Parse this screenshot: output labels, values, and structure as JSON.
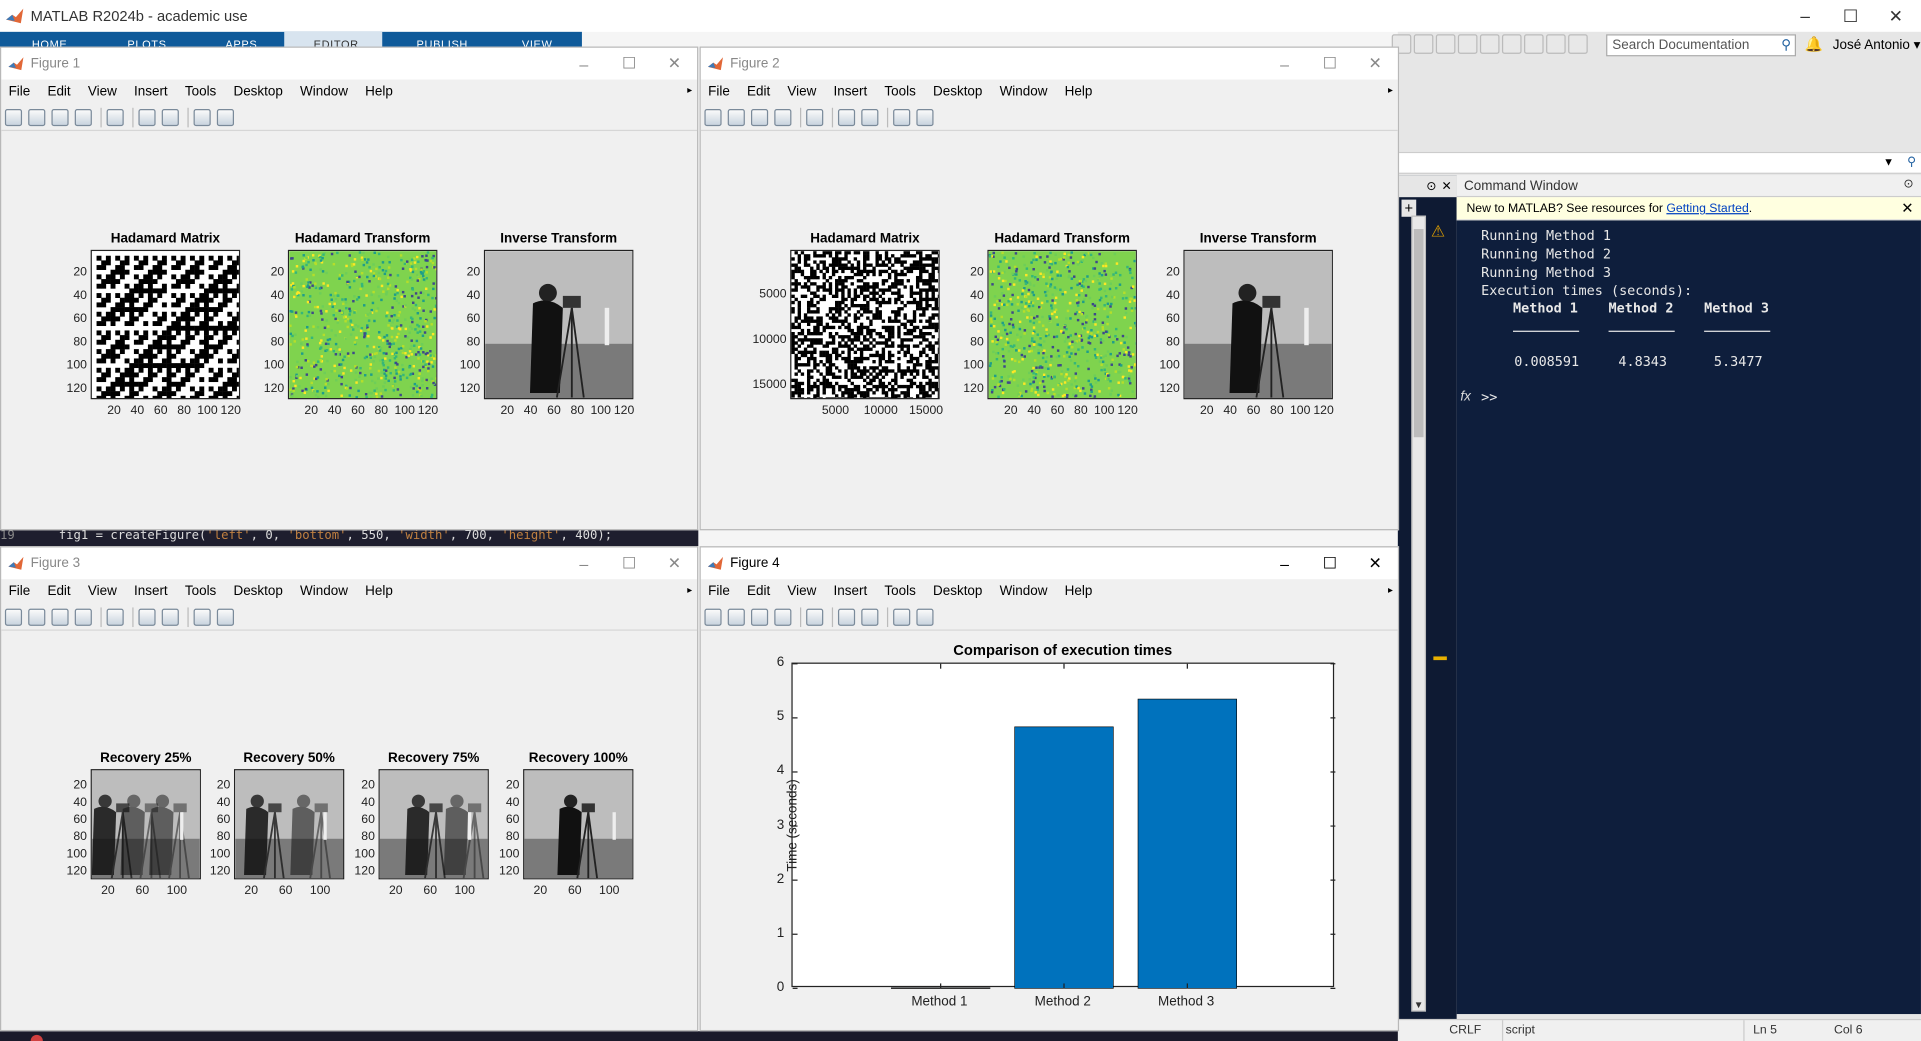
{
  "app": {
    "title": "MATLAB R2024b - academic use",
    "ribbon_tabs": [
      "HOME",
      "PLOTS",
      "APPS",
      "EDITOR",
      "PUBLISH",
      "VIEW"
    ],
    "search_placeholder": "Search Documentation",
    "user": "José Antonio",
    "window_controls": [
      "–",
      "☐",
      "✕"
    ]
  },
  "figure_menu": [
    "File",
    "Edit",
    "View",
    "Insert",
    "Tools",
    "Desktop",
    "Window",
    "Help"
  ],
  "figures": [
    {
      "title": "Figure 1",
      "axes": [
        {
          "title": "Hadamard Matrix",
          "yticks": [
            "20",
            "40",
            "60",
            "80",
            "100",
            "120"
          ],
          "xticks": [
            "20",
            "40",
            "60",
            "80",
            "100",
            "120"
          ],
          "kind": "hadamard"
        },
        {
          "title": "Hadamard Transform",
          "yticks": [
            "20",
            "40",
            "60",
            "80",
            "100",
            "120"
          ],
          "xticks": [
            "20",
            "40",
            "60",
            "80",
            "100",
            "120"
          ],
          "kind": "transform"
        },
        {
          "title": "Inverse Transform",
          "yticks": [
            "20",
            "40",
            "60",
            "80",
            "100",
            "120"
          ],
          "xticks": [
            "20",
            "40",
            "60",
            "80",
            "100",
            "120"
          ],
          "kind": "photo"
        }
      ]
    },
    {
      "title": "Figure 2",
      "axes": [
        {
          "title": "Hadamard Matrix",
          "yticks": [
            "5000",
            "10000",
            "15000"
          ],
          "xticks": [
            "5000",
            "10000",
            "15000"
          ],
          "kind": "noise"
        },
        {
          "title": "Hadamard Transform",
          "yticks": [
            "20",
            "40",
            "60",
            "80",
            "100",
            "120"
          ],
          "xticks": [
            "20",
            "40",
            "60",
            "80",
            "100",
            "120"
          ],
          "kind": "transform"
        },
        {
          "title": "Inverse Transform",
          "yticks": [
            "20",
            "40",
            "60",
            "80",
            "100",
            "120"
          ],
          "xticks": [
            "20",
            "40",
            "60",
            "80",
            "100",
            "120"
          ],
          "kind": "photo"
        }
      ]
    },
    {
      "title": "Figure 3",
      "axes": [
        {
          "title": "Recovery 25%",
          "yticks": [
            "20",
            "40",
            "60",
            "80",
            "100",
            "120"
          ],
          "xticks": [
            "20",
            "60",
            "100"
          ],
          "kind": "r25"
        },
        {
          "title": "Recovery 50%",
          "yticks": [
            "20",
            "40",
            "60",
            "80",
            "100",
            "120"
          ],
          "xticks": [
            "20",
            "60",
            "100"
          ],
          "kind": "r50"
        },
        {
          "title": "Recovery 75%",
          "yticks": [
            "20",
            "40",
            "60",
            "80",
            "100",
            "120"
          ],
          "xticks": [
            "20",
            "60",
            "100"
          ],
          "kind": "r75"
        },
        {
          "title": "Recovery 100%",
          "yticks": [
            "20",
            "40",
            "60",
            "80",
            "100",
            "120"
          ],
          "xticks": [
            "20",
            "60",
            "100"
          ],
          "kind": "photo"
        }
      ]
    },
    {
      "title": "Figure 4"
    }
  ],
  "chart_data": {
    "type": "bar",
    "title": "Comparison of execution times",
    "categories": [
      "Method 1",
      "Method 2",
      "Method 3"
    ],
    "values": [
      0.008591,
      4.8343,
      5.3477
    ],
    "xlabel": "",
    "ylabel": "Time (seconds)",
    "ylim": [
      0,
      6
    ],
    "yticks": [
      "0",
      "1",
      "2",
      "3",
      "4",
      "5",
      "6"
    ],
    "bar_color": "#0072bd",
    "grid": false
  },
  "editor": {
    "line_number": "19",
    "code_prefix": "fig1 = createFigure(",
    "code_parts": [
      "'left'",
      ", 0, ",
      "'bottom'",
      ", 550, ",
      "'width'",
      ", 700, ",
      "'height'",
      ", 400);"
    ]
  },
  "command_window": {
    "title": "Command Window",
    "banner_text": "New to MATLAB? See resources for ",
    "banner_link": "Getting Started",
    "banner_end": ".",
    "lines": [
      "Running Method 1",
      "Running Method 2",
      "Running Method 3",
      "Execution times (seconds):"
    ],
    "table_headers": [
      "Method 1",
      "Method 2",
      "Method 3"
    ],
    "table_values": [
      "0.008591",
      "4.8343",
      "5.3477"
    ],
    "prompt": ">>",
    "fx": "fx"
  },
  "statusbar": {
    "eol": "CRLF",
    "type": "script",
    "ln": "Ln  5",
    "col": "Col  6"
  },
  "colors": {
    "ribbon": "#0f5a9a",
    "command_bg": "#0e1e3c",
    "bar": "#0072bd"
  }
}
